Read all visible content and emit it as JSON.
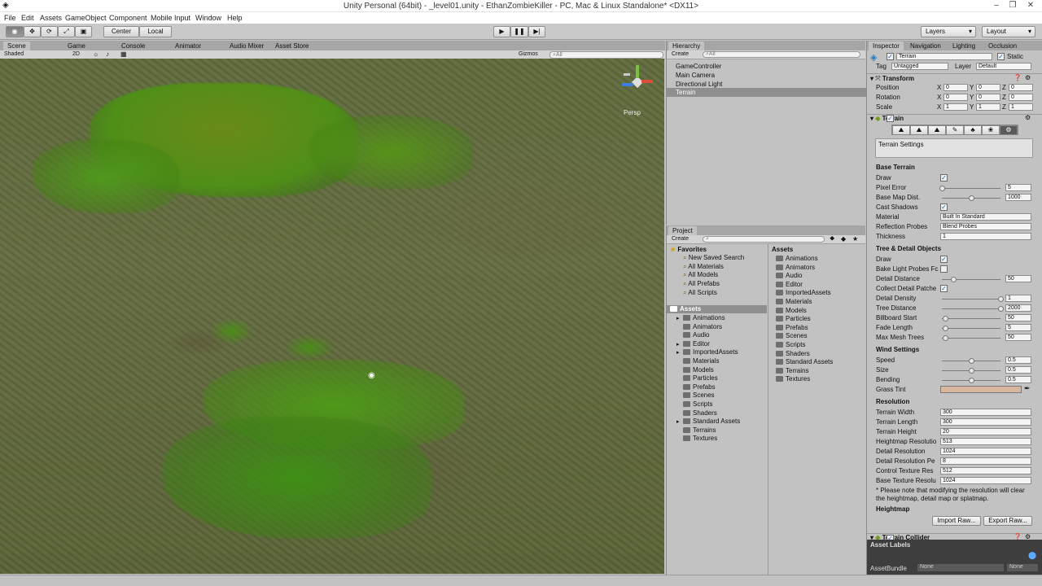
{
  "window": {
    "title": "Unity Personal (64bit) - _level01.unity - EthanZombieKiller - PC, Mac & Linux Standalone* <DX11>",
    "app_icon": "unity-logo-icon"
  },
  "menu": [
    "File",
    "Edit",
    "Assets",
    "GameObject",
    "Component",
    "Mobile Input",
    "Window",
    "Help"
  ],
  "toolbar": {
    "center_label": "Center",
    "local_label": "Local",
    "layers_label": "Layers",
    "layout_label": "Layout"
  },
  "scene_tabs": [
    "Scene",
    "Game",
    "Console",
    "Animator",
    "Audio Mixer",
    "Asset Store"
  ],
  "scene_bar": {
    "shading": "Shaded",
    "mode_2d": "2D",
    "gizmos": "Gizmos",
    "search_placeholder": "All"
  },
  "scene": {
    "persp_label": "Persp"
  },
  "hierarchy": {
    "tab": "Hierarchy",
    "create": "Create",
    "search_placeholder": "All",
    "items": [
      "GameController",
      "Main Camera",
      "Directional Light",
      "Terrain"
    ],
    "selected": "Terrain"
  },
  "project": {
    "tab": "Project",
    "create": "Create",
    "favorites_label": "Favorites",
    "favorites": [
      "New Saved Search",
      "All Materials",
      "All Models",
      "All Prefabs",
      "All Scripts"
    ],
    "assets_label": "Assets",
    "tree": [
      "Animations",
      "Animators",
      "Audio",
      "Editor",
      "ImportedAssets",
      "Materials",
      "Models",
      "Particles",
      "Prefabs",
      "Scenes",
      "Scripts",
      "Shaders",
      "Standard Assets",
      "Terrains",
      "Textures"
    ],
    "right_header": "Assets",
    "right_items": [
      "Animations",
      "Animators",
      "Audio",
      "Editor",
      "ImportedAssets",
      "Materials",
      "Models",
      "Particles",
      "Prefabs",
      "Scenes",
      "Scripts",
      "Shaders",
      "Standard Assets",
      "Terrains",
      "Textures"
    ]
  },
  "inspector": {
    "tabs": [
      "Inspector",
      "Navigation",
      "Lighting",
      "Occlusion"
    ],
    "object_name": "Terrain",
    "static_label": "Static",
    "tag_label": "Tag",
    "tag_value": "Untagged",
    "layer_label": "Layer",
    "layer_value": "Default",
    "transform": {
      "title": "Transform",
      "rows": [
        {
          "label": "Position",
          "x": "0",
          "y": "0",
          "z": "0"
        },
        {
          "label": "Rotation",
          "x": "0",
          "y": "0",
          "z": "0"
        },
        {
          "label": "Scale",
          "x": "1",
          "y": "1",
          "z": "1"
        }
      ]
    },
    "terrain_title": "Terrain",
    "settings_box": "Terrain Settings",
    "base_terrain": {
      "title": "Base Terrain",
      "draw": "Draw",
      "pixel_error": {
        "label": "Pixel Error",
        "value": "5",
        "fraction": 0.0
      },
      "base_map_dist": {
        "label": "Base Map Dist.",
        "value": "1000",
        "fraction": 0.5
      },
      "cast_shadows": "Cast Shadows",
      "material": {
        "label": "Material",
        "value": "Built In Standard"
      },
      "reflection": {
        "label": "Reflection Probes",
        "value": "Blend Probes"
      },
      "thickness": {
        "label": "Thickness",
        "value": "1"
      }
    },
    "tree_detail": {
      "title": "Tree & Detail Objects",
      "draw": "Draw",
      "bake": "Bake Light Probes Fc",
      "detail_distance": {
        "label": "Detail Distance",
        "value": "50",
        "fraction": 0.2
      },
      "collect": "Collect Detail Patche",
      "detail_density": {
        "label": "Detail Density",
        "value": "1",
        "fraction": 1.0
      },
      "tree_distance": {
        "label": "Tree Distance",
        "value": "2000",
        "fraction": 1.0
      },
      "billboard": {
        "label": "Billboard Start",
        "value": "50",
        "fraction": 0.05
      },
      "fade": {
        "label": "Fade Length",
        "value": "5",
        "fraction": 0.05
      },
      "max_mesh": {
        "label": "Max Mesh Trees",
        "value": "50",
        "fraction": 0.05
      }
    },
    "wind": {
      "title": "Wind Settings",
      "speed": {
        "label": "Speed",
        "value": "0.5",
        "fraction": 0.5
      },
      "size": {
        "label": "Size",
        "value": "0.5",
        "fraction": 0.5
      },
      "bending": {
        "label": "Bending",
        "value": "0.5",
        "fraction": 0.5
      },
      "grass_tint": "Grass Tint",
      "grass_tint_color": "#d9b79e"
    },
    "resolution": {
      "title": "Resolution",
      "rows": [
        {
          "label": "Terrain Width",
          "value": "300"
        },
        {
          "label": "Terrain Length",
          "value": "300"
        },
        {
          "label": "Terrain Height",
          "value": "20"
        },
        {
          "label": "Heightmap Resolutio",
          "value": "513"
        },
        {
          "label": "Detail Resolution",
          "value": "1024"
        },
        {
          "label": "Detail Resolution Pe",
          "value": "8"
        },
        {
          "label": "Control Texture Res",
          "value": "512"
        },
        {
          "label": "Base Texture Resolu",
          "value": "1024"
        }
      ],
      "note": "* Please note that modifying the resolution will clear the heightmap, detail map or splatmap."
    },
    "heightmap": {
      "title": "Heightmap",
      "import": "Import Raw...",
      "export": "Export Raw..."
    },
    "collider_title": "Terrain Collider",
    "asset_labels": "Asset Labels",
    "asset_bundle": "AssetBundle",
    "bundle_value": "None",
    "bundle_variant": "None"
  }
}
